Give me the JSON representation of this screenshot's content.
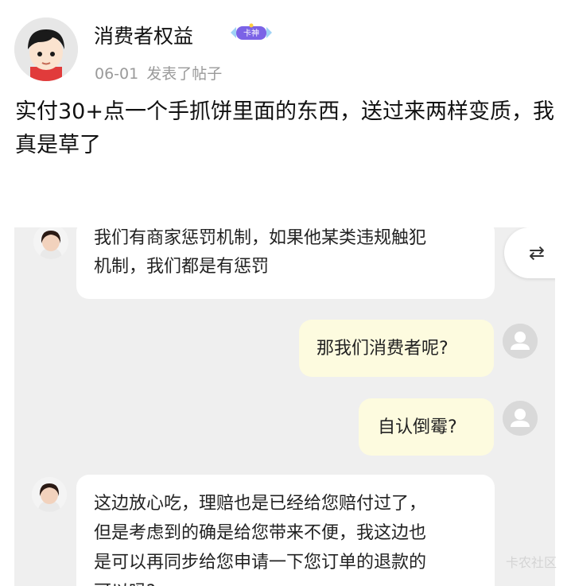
{
  "post": {
    "username": "消费者权益",
    "badge_text": "卡神",
    "date": "06-01",
    "action": "发表了帖子",
    "body": "实付30+点一个手抓饼里面的东西，送过来两样变质，我真是草了"
  },
  "chat": {
    "messages": [
      {
        "side": "left",
        "text_lines": [
          "我们有商家惩罚机制，如果他某类违规触犯",
          "机制，我们都是有惩罚"
        ]
      },
      {
        "side": "right",
        "text": "那我们消费者呢?"
      },
      {
        "side": "right",
        "text": "自认倒霉?"
      },
      {
        "side": "left",
        "text_lines": [
          "这边放心吃，理赔也是已经给您赔付过了，",
          "但是考虑到的确是给您带来不便，我这边也",
          "是可以再同步给您申请一下您订单的退款的",
          "可以吗?"
        ]
      }
    ],
    "switch_icon": "⇄"
  },
  "watermark": "卡农社区"
}
